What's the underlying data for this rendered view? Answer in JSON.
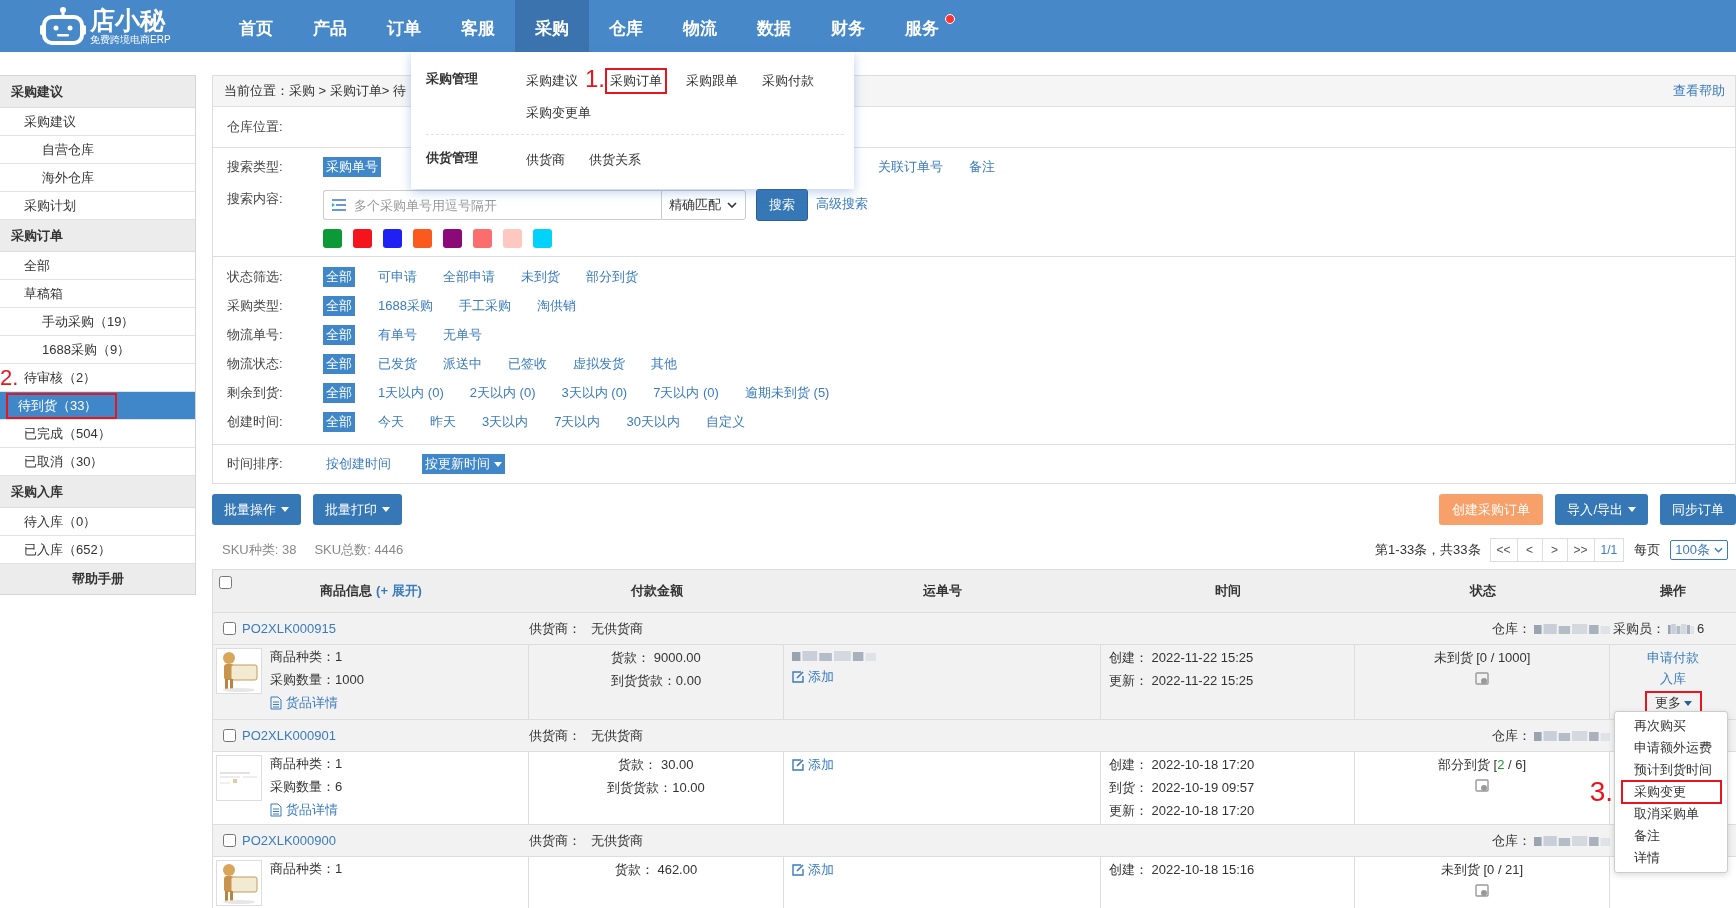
{
  "nav": {
    "logo_name": "店小秘",
    "logo_tagline": "免费跨境电商ERP",
    "items": [
      {
        "label": "首页",
        "selected": false,
        "badge": false
      },
      {
        "label": "产品",
        "selected": false,
        "badge": false
      },
      {
        "label": "订单",
        "selected": false,
        "badge": false
      },
      {
        "label": "客服",
        "selected": false,
        "badge": false
      },
      {
        "label": "采购",
        "selected": true,
        "badge": false
      },
      {
        "label": "仓库",
        "selected": false,
        "badge": false
      },
      {
        "label": "物流",
        "selected": false,
        "badge": false
      },
      {
        "label": "数据",
        "selected": false,
        "badge": false
      },
      {
        "label": "财务",
        "selected": false,
        "badge": false
      },
      {
        "label": "服务",
        "selected": false,
        "badge": true
      }
    ]
  },
  "nav_menu": {
    "groups": [
      {
        "title": "采购管理",
        "items": [
          {
            "label": "采购建议",
            "highlighted": false
          },
          {
            "label": "采购订单",
            "highlighted": true,
            "annotation": "1."
          },
          {
            "label": "采购跟单",
            "highlighted": false
          },
          {
            "label": "采购付款",
            "highlighted": false
          },
          {
            "label": "采购变更单",
            "highlighted": false
          }
        ]
      },
      {
        "title": "供货管理",
        "items": [
          {
            "label": "供货商",
            "highlighted": false
          },
          {
            "label": "供货关系",
            "highlighted": false
          }
        ]
      }
    ]
  },
  "sidebar": {
    "sections": [
      {
        "title": "采购建议",
        "items": [
          {
            "label": "采购建议",
            "selected": false,
            "children": [
              {
                "label": "自营仓库",
                "selected": false
              },
              {
                "label": "海外仓库",
                "selected": false
              }
            ]
          },
          {
            "label": "采购计划",
            "selected": false
          }
        ]
      },
      {
        "title": "采购订单",
        "items": [
          {
            "label": "全部",
            "selected": false
          },
          {
            "label": "草稿箱",
            "selected": false,
            "children": [
              {
                "label": "手动采购（19）",
                "selected": false
              },
              {
                "label": "1688采购（9）",
                "selected": false
              }
            ]
          },
          {
            "label": "待审核（2）",
            "selected": false
          },
          {
            "label": "待到货（33）",
            "selected": true,
            "highlighted": true,
            "annotation": "2."
          },
          {
            "label": "已完成（504）",
            "selected": false
          },
          {
            "label": "已取消（30）",
            "selected": false
          }
        ]
      },
      {
        "title": "采购入库",
        "items": [
          {
            "label": "待入库（0）",
            "selected": false
          },
          {
            "label": "已入库（652）",
            "selected": false
          }
        ]
      }
    ],
    "help_link": "帮助手册"
  },
  "breadcrumb": "当前位置：采购 > 采购订单> 待",
  "help_link": "查看帮助",
  "warehouse_label": "仓库位置:",
  "search_type": {
    "label": "搜索类型:",
    "options": [
      {
        "label": "采购单号",
        "selected": true
      },
      {
        "label": "关联订单号",
        "selected": false
      },
      {
        "label": "备注",
        "selected": false
      }
    ]
  },
  "search": {
    "label": "搜索内容:",
    "placeholder": "多个采购单号用逗号隔开",
    "match": "精确匹配",
    "button": "搜索",
    "advanced": "高级搜索"
  },
  "color_tags": [
    {
      "color": "#0b9a35"
    },
    {
      "color": "#f5141e"
    },
    {
      "color": "#2020f5"
    },
    {
      "color": "#fa5a1e"
    },
    {
      "color": "#8c0a78"
    },
    {
      "color": "#fa6e6e"
    },
    {
      "color": "#fcc8c0"
    },
    {
      "color": "#00d2fa"
    }
  ],
  "filters": [
    {
      "label": "状态筛选:",
      "options": [
        {
          "label": "全部",
          "selected": true
        },
        {
          "label": "可申请",
          "selected": false
        },
        {
          "label": "全部申请",
          "selected": false
        },
        {
          "label": "未到货",
          "selected": false
        },
        {
          "label": "部分到货",
          "selected": false
        }
      ]
    },
    {
      "label": "采购类型:",
      "options": [
        {
          "label": "全部",
          "selected": true
        },
        {
          "label": "1688采购",
          "selected": false
        },
        {
          "label": "手工采购",
          "selected": false
        },
        {
          "label": "淘供销",
          "selected": false
        }
      ]
    },
    {
      "label": "物流单号:",
      "options": [
        {
          "label": "全部",
          "selected": true
        },
        {
          "label": "有单号",
          "selected": false
        },
        {
          "label": "无单号",
          "selected": false
        }
      ]
    },
    {
      "label": "物流状态:",
      "options": [
        {
          "label": "全部",
          "selected": true
        },
        {
          "label": "已发货",
          "selected": false
        },
        {
          "label": "派送中",
          "selected": false
        },
        {
          "label": "已签收",
          "selected": false
        },
        {
          "label": "虚拟发货",
          "selected": false
        },
        {
          "label": "其他",
          "selected": false
        }
      ]
    },
    {
      "label": "剩余到货:",
      "options": [
        {
          "label": "全部",
          "selected": true
        },
        {
          "label": "1天以内 (0)",
          "selected": false
        },
        {
          "label": "2天以内 (0)",
          "selected": false
        },
        {
          "label": "3天以内 (0)",
          "selected": false
        },
        {
          "label": "7天以内 (0)",
          "selected": false
        },
        {
          "label": "逾期未到货 (5)",
          "selected": false
        }
      ]
    },
    {
      "label": "创建时间:",
      "options": [
        {
          "label": "全部",
          "selected": true
        },
        {
          "label": "今天",
          "selected": false
        },
        {
          "label": "昨天",
          "selected": false
        },
        {
          "label": "3天以内",
          "selected": false
        },
        {
          "label": "7天以内",
          "selected": false
        },
        {
          "label": "30天以内",
          "selected": false
        },
        {
          "label": "自定义",
          "selected": false
        }
      ]
    }
  ],
  "sort": {
    "label": "时间排序:",
    "options": [
      {
        "label": "按创建时间",
        "selected": false
      },
      {
        "label": "按更新时间",
        "selected": true
      }
    ]
  },
  "toolbar": {
    "left": [
      "批量操作",
      "批量打印"
    ],
    "right": [
      {
        "label": "创建采购订单",
        "kind": "primary"
      },
      {
        "label": "导入/导出",
        "kind": "menu"
      },
      {
        "label": "同步订单",
        "kind": "plain"
      }
    ]
  },
  "summary": {
    "sku_kinds": "SKU种类: 38",
    "sku_total": "SKU总数: 4446",
    "range": "第1-33条，共33条",
    "pager": [
      "<<",
      "<",
      ">",
      ">>",
      "1/1"
    ],
    "per_page_label": "每页",
    "per_page": "100条"
  },
  "table": {
    "select_all_checked": false,
    "columns": [
      "商品信息",
      "付款金额",
      "运单号",
      "时间",
      "状态",
      "操作"
    ],
    "expand_link": "(+ 展开)"
  },
  "orders": [
    {
      "number": "PO2XLK000915",
      "checked": false,
      "supplier_label": "供货商：",
      "supplier": "无供货商",
      "warehouse_label": "仓库：",
      "buyer_label": "采购员：",
      "buyer": "6",
      "product_lines": [
        "商品种类：1",
        "采购数量：1000"
      ],
      "detail_link": "货品详情",
      "payment_lines": [
        "货款：  9000.00",
        "到货货款：0.00"
      ],
      "waybill_blurred": true,
      "add_link": "添加",
      "times": [
        "创建：  2022-11-22 15:25",
        "更新：  2022-11-22 15:25"
      ],
      "status": "未到货 [",
      "received": "0",
      "total": " / 1000]",
      "partial": false,
      "ops": [
        "申请付款",
        "入库"
      ],
      "more": {
        "label": "更多",
        "highlighted": true,
        "menu": [
          {
            "label": "再次购买",
            "highlighted": false
          },
          {
            "label": "申请额外运费",
            "highlighted": false
          },
          {
            "label": "预计到货时间",
            "highlighted": false
          },
          {
            "label": "采购变更",
            "highlighted": true,
            "annotation": "3."
          },
          {
            "label": "取消采购单",
            "highlighted": false
          },
          {
            "label": "备注",
            "highlighted": false
          },
          {
            "label": "详情",
            "highlighted": false
          }
        ]
      }
    },
    {
      "number": "PO2XLK000901",
      "checked": false,
      "supplier_label": "供货商：",
      "supplier": "无供货商",
      "warehouse_label": "仓库：",
      "product_lines": [
        "商品种类：1",
        "采购数量：6"
      ],
      "detail_link": "货品详情",
      "payment_lines": [
        "货款：  30.00",
        "到货货款：10.00"
      ],
      "waybill_blurred": false,
      "add_link": "添加",
      "times": [
        "创建：  2022-10-18 17:20",
        "到货：  2022-10-19 09:57",
        "更新：  2022-10-18 17:20"
      ],
      "status": "部分到货 [",
      "received": "2",
      "total": " / 6]",
      "partial": true
    },
    {
      "number": "PO2XLK000900",
      "checked": false,
      "supplier_label": "供货商：",
      "supplier": "无供货商",
      "warehouse_label": "仓库：",
      "product_lines": [
        "商品种类：1"
      ],
      "payment_lines": [
        "货款：  462.00"
      ],
      "waybill_blurred": false,
      "add_link": "添加",
      "times": [
        "创建：  2022-10-18 15:16"
      ],
      "status": "未到货 [",
      "received": "0",
      "total": " / 21]",
      "partial": false
    }
  ]
}
